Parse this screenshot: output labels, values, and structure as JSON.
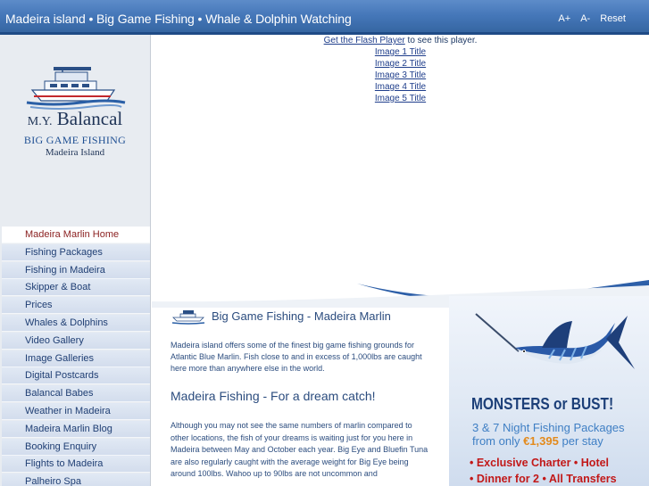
{
  "header": {
    "title": "Madeira island • Big Game Fishing • Whale & Dolphin Watching",
    "font_increase": "A+",
    "font_decrease": "A-",
    "font_reset": "Reset"
  },
  "logo": {
    "name_prefix": "M.Y.",
    "name": "Balancal",
    "tagline": "BIG GAME FISHING",
    "location": "Madeira Island"
  },
  "nav": {
    "items": [
      "Madeira Marlin Home",
      "Fishing Packages",
      "Fishing in Madeira",
      "Skipper & Boat",
      "Prices",
      "Whales & Dolphins",
      "Video Gallery",
      "Image Galleries",
      "Digital Postcards",
      "Balancal Babes",
      "Weather in Madeira",
      "Madeira Marlin Blog",
      "Booking Enquiry",
      "Flights to Madeira",
      "Palheiro Spa"
    ],
    "active_index": 0
  },
  "player": {
    "flash_link": "Get the Flash Player",
    "flash_suffix": "to see this player.",
    "image_titles": [
      "Image 1 Title",
      "Image 2 Title",
      "Image 3 Title",
      "Image 4 Title",
      "Image 5 Title"
    ]
  },
  "content": {
    "heading": "Big Game Fishing - Madeira Marlin",
    "intro": "Madeira island offers some of the finest big game fishing grounds for Atlantic Blue Marlin. Fish close to and in excess of 1,000lbs are caught here more than anywhere else in the world.",
    "subheading": "Madeira Fishing - For a dream catch!",
    "body": "Although you may not see the same numbers of marlin compared to other locations, the fish of your dreams is waiting just for you here in Madeira between May and October each year. Big Eye and Bluefin Tuna are also regularly caught with the average weight for Big Eye being around 100lbs. Wahoo up to 90lbs are not uncommon and"
  },
  "promo": {
    "headline": "MONSTERS or BUST!",
    "line1": "3 & 7 Night Fishing Packages",
    "line2_prefix": "from only",
    "price": "€1,395",
    "line2_suffix": "per stay",
    "bullet1": "• Exclusive Charter • Hotel",
    "bullet2": "• Dinner for 2 • All Transfers"
  },
  "colors": {
    "header_blue": "#4577b9",
    "active_nav": "#8a1e1e",
    "promo_red": "#c21818",
    "promo_orange": "#e38a1c"
  }
}
